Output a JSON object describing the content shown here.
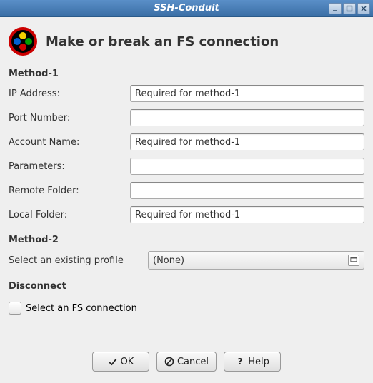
{
  "window": {
    "title": "SSH-Conduit"
  },
  "header": {
    "title": "Make or break an FS connection"
  },
  "method1": {
    "title": "Method-1",
    "rows": [
      {
        "label": "IP Address:",
        "value": "Required for method-1"
      },
      {
        "label": "Port Number:",
        "value": ""
      },
      {
        "label": "Account Name:",
        "value": "Required for method-1"
      },
      {
        "label": "Parameters:",
        "value": ""
      },
      {
        "label": "Remote Folder:",
        "value": ""
      },
      {
        "label": "Local Folder:",
        "value": "Required for method-1"
      }
    ]
  },
  "method2": {
    "title": "Method-2",
    "label": "Select an existing profile",
    "selected": "(None)"
  },
  "disconnect": {
    "title": "Disconnect",
    "checkbox_label": "Select an FS connection"
  },
  "buttons": {
    "ok": "OK",
    "cancel": "Cancel",
    "help": "Help"
  }
}
